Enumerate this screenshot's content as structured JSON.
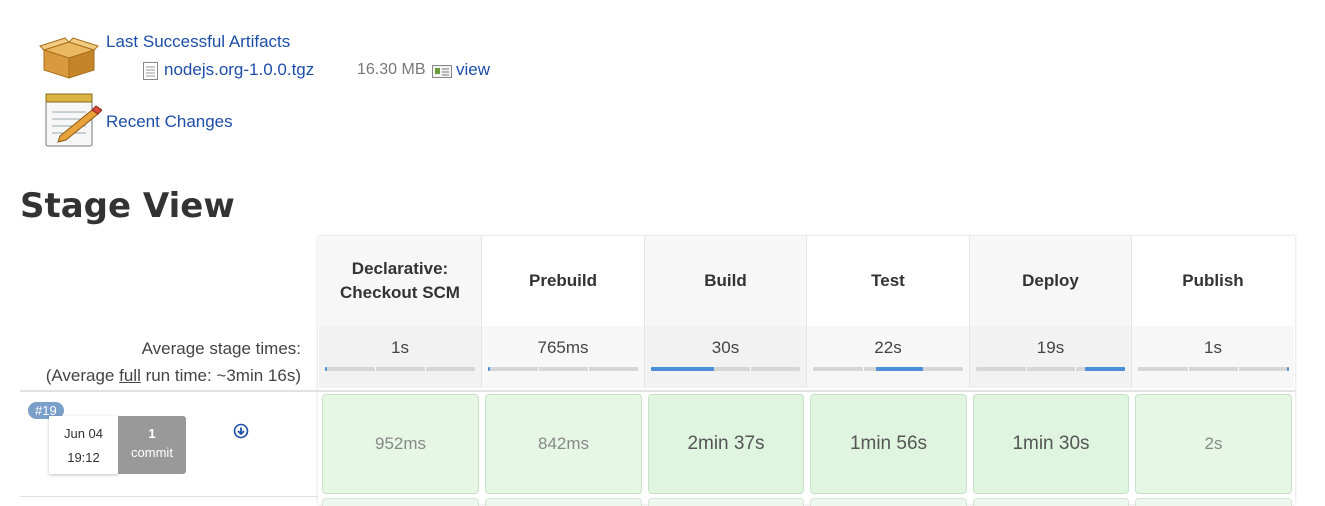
{
  "artifacts": {
    "title": "Last Successful Artifacts",
    "file_name": "nodejs.org-1.0.0.tgz",
    "file_size": "16.30 MB",
    "view_label": "view"
  },
  "recent_changes": "Recent Changes",
  "stage_view": {
    "title": "Stage View",
    "avg_stage_times_label": "Average stage times:",
    "avg_run_prefix": "(Average ",
    "avg_run_link": "full",
    "avg_run_suffix": " run time: ~3min 16s)",
    "stages": [
      {
        "name_line1": "Declarative:",
        "name_line2": "Checkout SCM",
        "avg": "1s",
        "run": "952ms",
        "fill_start": 0.0,
        "fill_end": 0.01
      },
      {
        "name_line1": "Prebuild",
        "name_line2": "",
        "avg": "765ms",
        "run": "842ms",
        "fill_start": 0.0,
        "fill_end": 0.01
      },
      {
        "name_line1": "Build",
        "name_line2": "",
        "avg": "30s",
        "run": "2min 37s",
        "fill_start": 0.0,
        "fill_end": 0.42
      },
      {
        "name_line1": "Test",
        "name_line2": "",
        "avg": "22s",
        "run": "1min 56s",
        "fill_start": 0.42,
        "fill_end": 0.73
      },
      {
        "name_line1": "Deploy",
        "name_line2": "",
        "avg": "19s",
        "run": "1min 30s",
        "fill_start": 0.73,
        "fill_end": 1.0
      },
      {
        "name_line1": "Publish",
        "name_line2": "",
        "avg": "1s",
        "run": "2s",
        "fill_start": 0.99,
        "fill_end": 1.0
      }
    ],
    "build": {
      "number": "#19",
      "date": "Jun 04",
      "time": "19:12",
      "commit_count": "1",
      "commit_label": "commit"
    }
  }
}
